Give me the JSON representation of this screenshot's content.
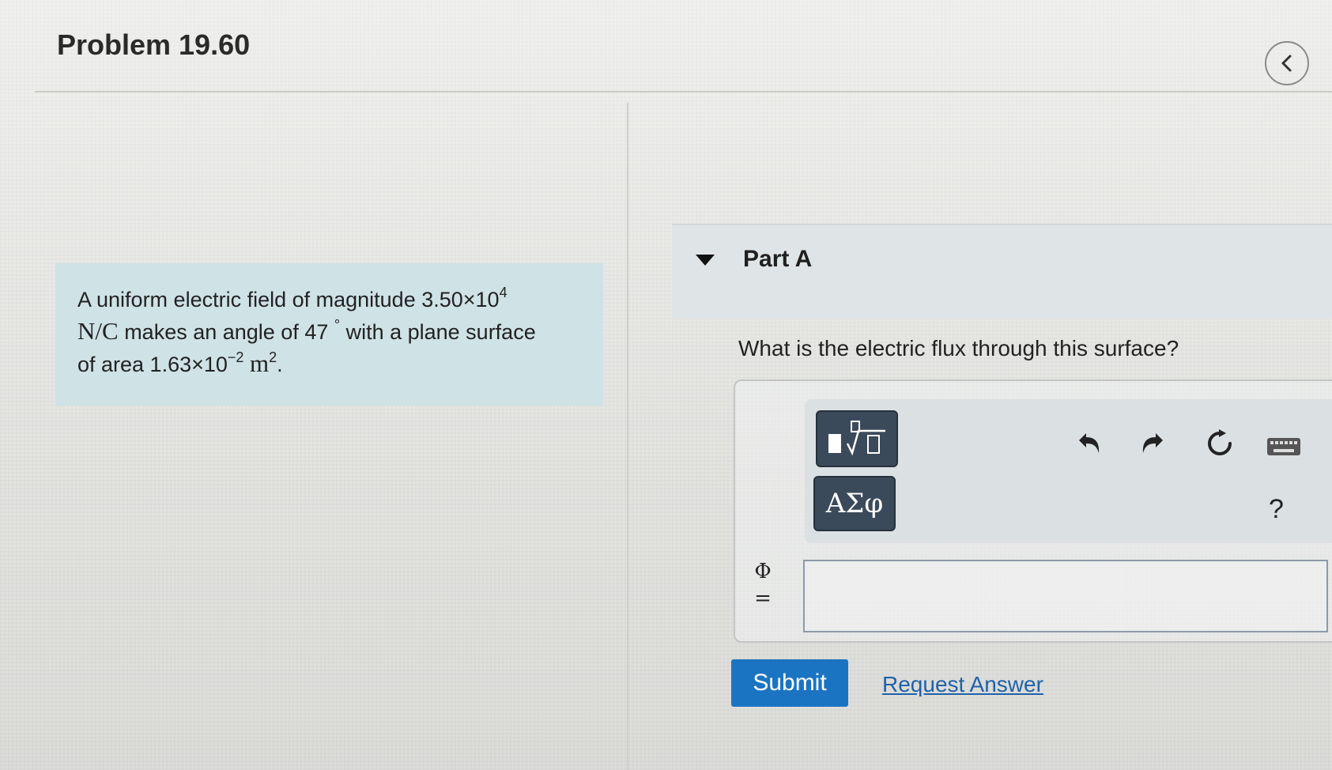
{
  "header": {
    "title": "Problem 19.60",
    "collapse_icon": "chevron-left-icon"
  },
  "problem": {
    "line1_text": "A uniform electric field of magnitude 3.50×10",
    "line1_exp": "4",
    "line2_unit": "N/C",
    "line2_text": " makes an angle of 47 ",
    "line2_deg": "°",
    "line2_rest": " with a plane surface",
    "line3_text": "of area 1.63×10",
    "line3_exp": "−2",
    "line3_unit": "m",
    "line3_unit_exp": "2",
    "line3_end": "."
  },
  "part_a": {
    "title": "Part A",
    "question": "What is the electric flux through this surface?",
    "greek_button_label": "ΑΣφ",
    "help_label": "?",
    "input_label_symbol": "Φ",
    "input_label_equals": "=",
    "input_value": "",
    "icons": {
      "templates": "templates-icon",
      "undo": "undo-icon",
      "redo": "redo-icon",
      "reset": "reset-icon",
      "keyboard": "keyboard-icon"
    }
  },
  "actions": {
    "submit_label": "Submit",
    "request_answer_label": "Request Answer"
  },
  "colors": {
    "problem_box": "#cfe2e6",
    "toolbar_button": "#3b4a5a",
    "submit": "#1b74c2",
    "link": "#1f62a8"
  }
}
